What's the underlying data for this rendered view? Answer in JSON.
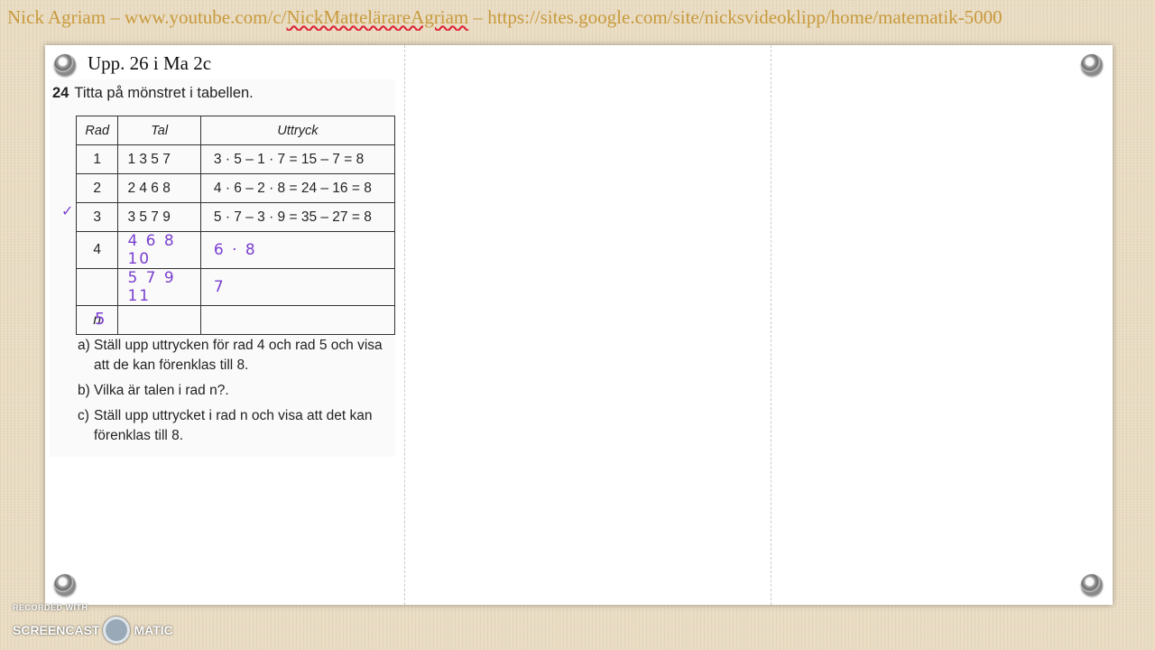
{
  "header": {
    "prefix": "Nick Agriam – www.youtube.com/c/",
    "link_text": "NickMattelärareAgriam",
    "suffix": " – https://sites.google.com/site/nicksvideoklipp/home/matematik-5000"
  },
  "slide": {
    "title": "Upp. 26 i Ma 2c"
  },
  "task": {
    "number": "24",
    "text": "Titta på mönstret i tabellen."
  },
  "table": {
    "headers": [
      "Rad",
      "Tal",
      "Uttryck"
    ],
    "rows": [
      {
        "rad": "1",
        "tal": "1 3 5 7",
        "uttryck": "3 · 5 – 1 · 7 = 15 – 7 = 8"
      },
      {
        "rad": "2",
        "tal": "2 4 6 8",
        "uttryck": "4 · 6 – 2 · 8 = 24 – 16 = 8"
      },
      {
        "rad": "3",
        "tal": "3 5 7 9",
        "uttryck": "5 · 7 – 3 · 9 = 35 – 27 = 8"
      },
      {
        "rad": "4",
        "tal": "4 6 8 10",
        "uttryck": "6 · 8"
      },
      {
        "rad": "",
        "tal": "5 7 9 11",
        "uttryck": "7"
      },
      {
        "rad": "n",
        "tal": "",
        "uttryck": ""
      }
    ]
  },
  "handwriting": {
    "row5_label": "5",
    "check": "✓"
  },
  "questions": [
    {
      "label": "a)",
      "text": "Ställ upp uttrycken för rad 4 och rad 5 och visa att de kan förenklas till 8."
    },
    {
      "label": "b)",
      "text": "Vilka är talen i rad n?."
    },
    {
      "label": "c)",
      "text": "Ställ upp uttrycket i rad n och visa att det kan förenklas till 8."
    }
  ],
  "watermark": {
    "top": "RECORDED WITH",
    "left": "SCREENCAST",
    "right": "MATIC"
  }
}
